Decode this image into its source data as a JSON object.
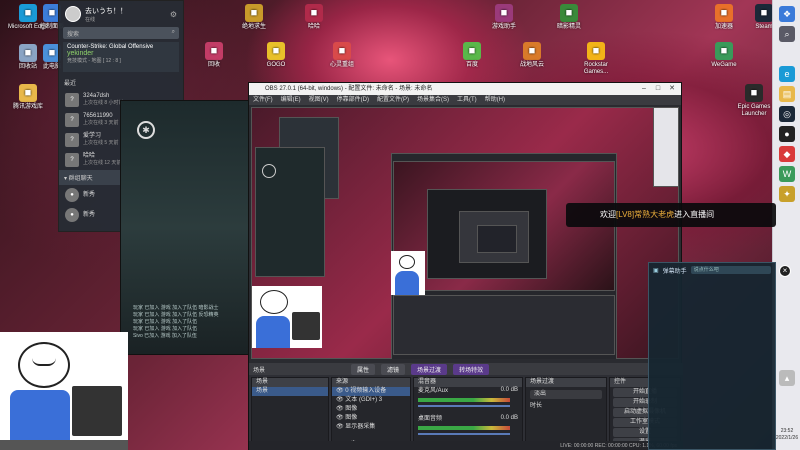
{
  "desktop": {
    "icons": [
      {
        "label": "Microsoft Edge",
        "icon": "edge-icon",
        "color": "#1a9ad6"
      },
      {
        "label": "控制面板",
        "icon": "control-panel-icon",
        "color": "#3c7dd9"
      },
      {
        "label": "回收站",
        "icon": "recycle-bin-icon",
        "color": "#8aa4c4"
      },
      {
        "label": "此电脑",
        "icon": "computer-icon",
        "color": "#4a90d9"
      },
      {
        "label": "腾讯游戏库",
        "icon": "folder-icon",
        "color": "#e8b84a"
      },
      {
        "label": "绝地求生",
        "icon": "pubg-icon",
        "color": "#c89a2a"
      },
      {
        "label": "哈哈",
        "icon": "app-icon",
        "color": "#b02a4a"
      },
      {
        "label": "游戏助手",
        "icon": "gamepad-icon",
        "color": "#9a3a7a"
      },
      {
        "label": "暗影精灵",
        "icon": "game-icon",
        "color": "#3a8a3a"
      },
      {
        "label": "加速器",
        "icon": "accelerator-icon",
        "color": "#e8702a"
      },
      {
        "label": "Steam",
        "icon": "steam-icon",
        "color": "#1b2838"
      },
      {
        "label": "回收",
        "icon": "app-icon",
        "color": "#c23c66"
      },
      {
        "label": "GOGO",
        "icon": "gogo-icon",
        "color": "#e8c02a"
      },
      {
        "label": "心灵重组",
        "icon": "app-icon",
        "color": "#d94a4a"
      },
      {
        "label": "百度",
        "icon": "app-icon",
        "color": "#5ab84a"
      },
      {
        "label": "战地风云",
        "icon": "game-icon",
        "color": "#d97a2a"
      },
      {
        "label": "Rockstar Games...",
        "icon": "rockstar-icon",
        "color": "#f2b318"
      },
      {
        "label": "WeGame",
        "icon": "wegame-icon",
        "color": "#3a9a5a"
      },
      {
        "label": "Epic Games Launcher",
        "icon": "epic-icon",
        "color": "#2a2a2a"
      }
    ]
  },
  "qq": {
    "username": "去いうち！！",
    "status": "在线",
    "search_placeholder": "搜索",
    "game": {
      "title": "Counter-Strike: Global Offensive",
      "player": "yekinder",
      "detail": "竞技模式 - 地图 [ 12 : 8 ]"
    },
    "section_recent": "最近",
    "contacts": [
      {
        "name": "324a7dsh",
        "sub": "上次在线 8 小时前"
      },
      {
        "name": "765611990",
        "sub": "上次在线 3 天前"
      },
      {
        "name": "爱学习",
        "sub": "上次在线 5 天前"
      },
      {
        "name": "哈哈",
        "sub": "上次在线 12 天前"
      }
    ],
    "section_groups": "▾ 群组聊天",
    "groups": [
      {
        "name": "新秀"
      },
      {
        "name": "新秀"
      }
    ]
  },
  "game_window": {
    "log_lines": [
      "玩家 已加入 游戏 加入了队伍 暗影战士",
      "玩家 已加入 游戏 加入了队伍 反恐精英",
      "玩家 已加入 游戏 加入了队伍",
      "玩家 已加入 游戏 加入了队伍",
      "Sivo 已加入 游戏 加入了队伍"
    ]
  },
  "obs": {
    "title": "OBS 27.0.1 (64-bit, windows) - 配置文件: 未命名 - 场景: 未命名",
    "menu": [
      "文件(F)",
      "编辑(E)",
      "视图(V)",
      "停靠部件(D)",
      "配置文件(P)",
      "场景集合(S)",
      "工具(T)",
      "帮助(H)"
    ],
    "scene_bar": {
      "current": "场景",
      "btn_properties": "属性",
      "btn_filters": "滤镜",
      "transition_label": "场景过渡",
      "transition_value": "转场特效"
    },
    "docks": {
      "scenes": {
        "title": "场景",
        "items": [
          "场景"
        ]
      },
      "sources": {
        "title": "来源",
        "items": [
          "0 视频输入设备",
          "文本 (GDI+) 3",
          "图像",
          "图像",
          "显示器采集"
        ]
      },
      "mixer": {
        "title": "混音器",
        "channels": [
          {
            "name": "麦克风/Aux",
            "value": "0.0 dB"
          },
          {
            "name": "桌面音频",
            "value": "0.0 dB"
          }
        ]
      },
      "transitions": {
        "title": "场景过渡",
        "value": "淡出",
        "duration_label": "时长"
      },
      "controls": {
        "title": "控件",
        "buttons": [
          "开始直播",
          "开始录制",
          "启动虚拟摄像机",
          "工作室模式",
          "设置",
          "退出"
        ]
      }
    },
    "status": "LIVE: 00:00:00   REC: 00:00:00   CPU: 1.1%, 60.00 fps"
  },
  "notification": {
    "prefix": "欢迎",
    "level": "[LV8]",
    "name": "常熟大老虎",
    "suffix": "进入直播间"
  },
  "danmaku": {
    "title": "弹幕助手",
    "input_placeholder": "说点什么吧"
  },
  "taskbar": {
    "time": "23:52",
    "date": "2022/1/26"
  }
}
